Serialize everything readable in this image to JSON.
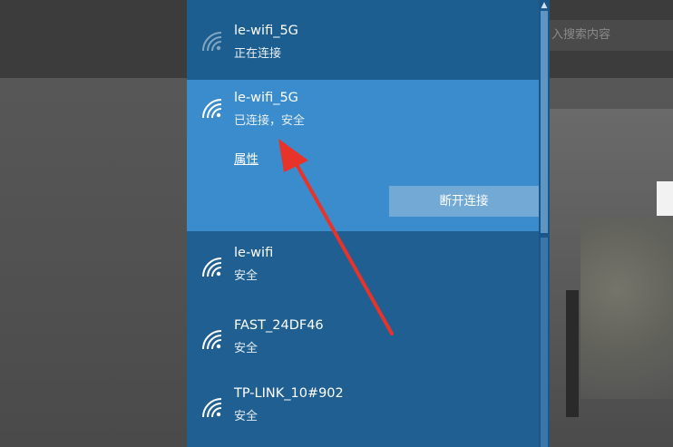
{
  "background": {
    "search_placeholder": "入搜索内容"
  },
  "networks": [
    {
      "ssid": "le-wifi_5G",
      "status": "正在连接",
      "icon": "wifi-signal-icon"
    },
    {
      "ssid": "le-wifi_5G",
      "status": "已连接，安全",
      "icon": "wifi-signal-icon",
      "properties_label": "属性",
      "disconnect_label": "断开连接"
    },
    {
      "ssid": "le-wifi",
      "status": "安全",
      "icon": "wifi-signal-icon"
    },
    {
      "ssid": "FAST_24DF46",
      "status": "安全",
      "icon": "wifi-signal-icon"
    },
    {
      "ssid": "TP-LINK_10#902",
      "status": "安全",
      "icon": "wifi-signal-icon"
    }
  ],
  "colors": {
    "flyout_bg": "#1f5f91",
    "selected_bg": "#3a8ccc",
    "button_bg": "#73a9d5",
    "annotation_arrow": "#e8332a"
  }
}
